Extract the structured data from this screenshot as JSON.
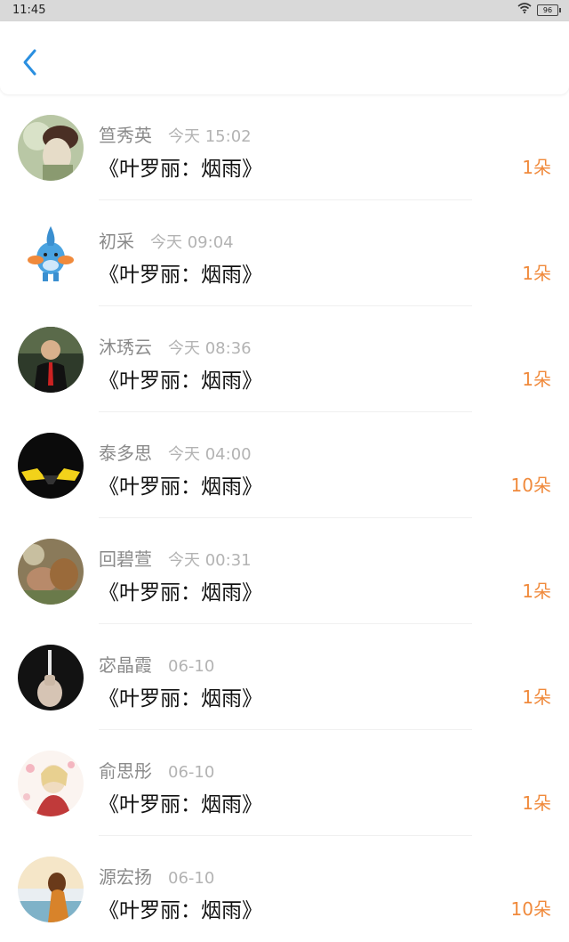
{
  "status_bar": {
    "time": "11:45",
    "battery": "96"
  },
  "header": {
    "back_icon": "chevron-left-icon",
    "accent_color": "#2a8fe0"
  },
  "list": {
    "count_color": "#f08a3c",
    "items": [
      {
        "name": "笪秀英",
        "time": "今天 15:02",
        "title": "《叶罗丽：烟雨》",
        "count": "1朵"
      },
      {
        "name": "初采",
        "time": "今天 09:04",
        "title": "《叶罗丽：烟雨》",
        "count": "1朵"
      },
      {
        "name": "沐琇云",
        "time": "今天 08:36",
        "title": "《叶罗丽：烟雨》",
        "count": "1朵"
      },
      {
        "name": "泰多思",
        "time": "今天 04:00",
        "title": "《叶罗丽：烟雨》",
        "count": "10朵"
      },
      {
        "name": "回碧萱",
        "time": "今天 00:31",
        "title": "《叶罗丽：烟雨》",
        "count": "1朵"
      },
      {
        "name": "宓晶霞",
        "time": "06-10",
        "title": "《叶罗丽：烟雨》",
        "count": "1朵"
      },
      {
        "name": "俞思彤",
        "time": "06-10",
        "title": "《叶罗丽：烟雨》",
        "count": "1朵"
      },
      {
        "name": "源宏扬",
        "time": "06-10",
        "title": "《叶罗丽：烟雨》",
        "count": "10朵"
      }
    ]
  }
}
